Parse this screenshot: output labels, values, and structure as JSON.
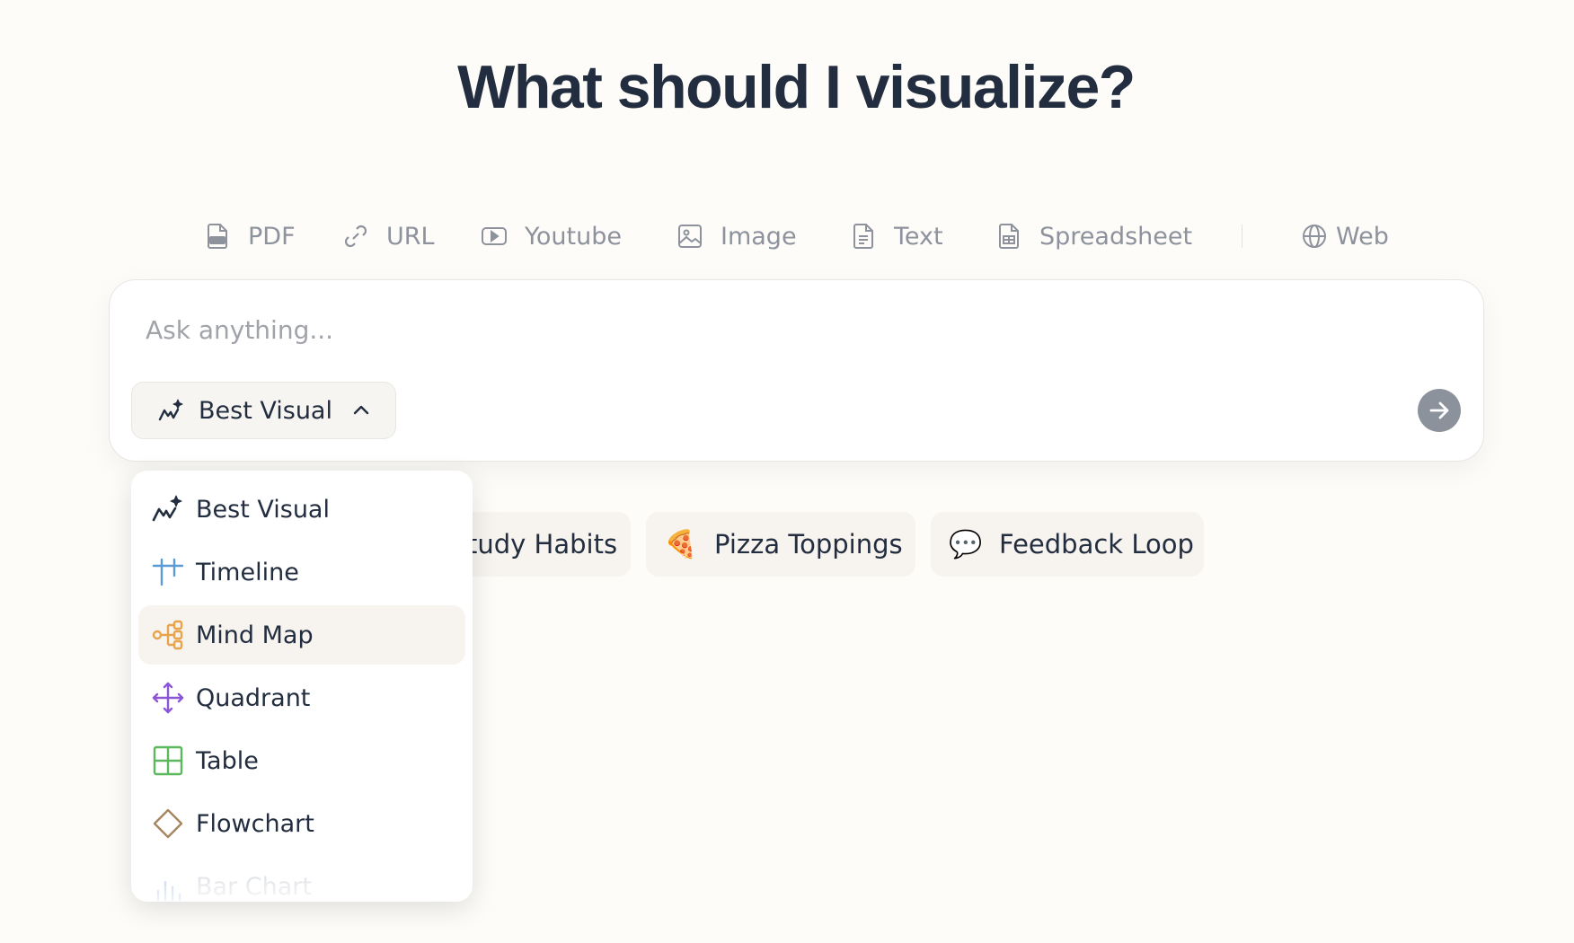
{
  "heading": "What should I visualize?",
  "sources": [
    {
      "label": "PDF",
      "icon": "pdf-file-icon"
    },
    {
      "label": "URL",
      "icon": "link-icon"
    },
    {
      "label": "Youtube",
      "icon": "youtube-icon"
    },
    {
      "label": "Image",
      "icon": "image-icon"
    },
    {
      "label": "Text",
      "icon": "text-file-icon"
    },
    {
      "label": "Spreadsheet",
      "icon": "spreadsheet-icon"
    },
    {
      "label": "Web",
      "icon": "globe-icon"
    }
  ],
  "prompt": {
    "placeholder": "Ask anything...",
    "visual_type_label": "Best Visual"
  },
  "chips": [
    {
      "label": "tudy Habits",
      "emoji": ""
    },
    {
      "label": "Pizza Toppings",
      "emoji": "🍕"
    },
    {
      "label": "Feedback Loop",
      "emoji": "💬"
    }
  ],
  "dropdown": {
    "items": [
      {
        "label": "Best Visual",
        "icon": "sparkle-chart-icon",
        "color": "#222d3f"
      },
      {
        "label": "Timeline",
        "icon": "timeline-icon",
        "color": "#5b9bd5"
      },
      {
        "label": "Mind Map",
        "icon": "mind-map-icon",
        "color": "#e8a44a"
      },
      {
        "label": "Quadrant",
        "icon": "quadrant-arrows-icon",
        "color": "#8b55d6"
      },
      {
        "label": "Table",
        "icon": "table-icon",
        "color": "#5cb85c"
      },
      {
        "label": "Flowchart",
        "icon": "diamond-icon",
        "color": "#a68660"
      },
      {
        "label": "Bar Chart",
        "icon": "bar-chart-icon",
        "color": "#9fb9e8"
      }
    ],
    "active_item": "Mind Map"
  }
}
